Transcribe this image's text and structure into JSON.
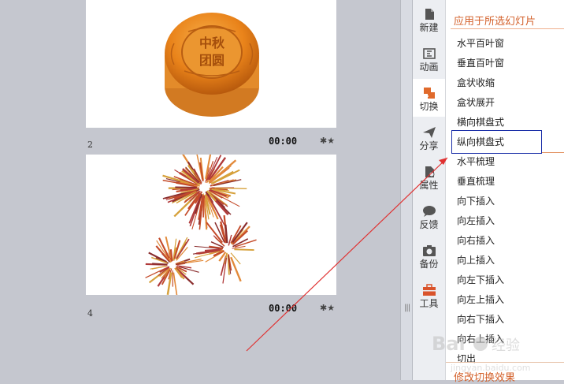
{
  "slides": [
    {
      "number": "2",
      "time": "00:00",
      "image": "mooncake",
      "mooncake_text": "中秋团圆"
    },
    {
      "number": "4",
      "time": "00:00",
      "image": "fireworks"
    }
  ],
  "toolbar": [
    {
      "id": "new",
      "label": "新建",
      "icon": "document-icon"
    },
    {
      "id": "anim",
      "label": "动画",
      "icon": "animation-icon"
    },
    {
      "id": "switch",
      "label": "切换",
      "icon": "transition-icon",
      "active": true
    },
    {
      "id": "share",
      "label": "分享",
      "icon": "paper-plane-icon"
    },
    {
      "id": "props",
      "label": "属性",
      "icon": "properties-icon"
    },
    {
      "id": "feedback",
      "label": "反馈",
      "icon": "chat-icon"
    },
    {
      "id": "backup",
      "label": "备份",
      "icon": "camera-icon"
    },
    {
      "id": "tools",
      "label": "工具",
      "icon": "toolbox-icon"
    }
  ],
  "panel": {
    "title": "应用于所选幻灯片",
    "effects": [
      "水平百叶窗",
      "垂直百叶窗",
      "盒状收缩",
      "盒状展开",
      "横向棋盘式",
      "纵向棋盘式",
      "水平梳理",
      "垂直梳理",
      "向下插入",
      "向左插入",
      "向右插入",
      "向上插入",
      "向左下插入",
      "向左上插入",
      "向右下插入",
      "向右上插入",
      "切出"
    ],
    "selected_index": 5,
    "bottom_link": "修改切换效果"
  },
  "colors": {
    "accent": "#d3602a",
    "selection_box": "#1b2fa8",
    "arrow": "#e03030",
    "sorter_bg": "#c5c7cf"
  },
  "watermark": {
    "brand": "Bai",
    "brand_tail": "经验",
    "sub": "jingyan.baidu.com"
  }
}
